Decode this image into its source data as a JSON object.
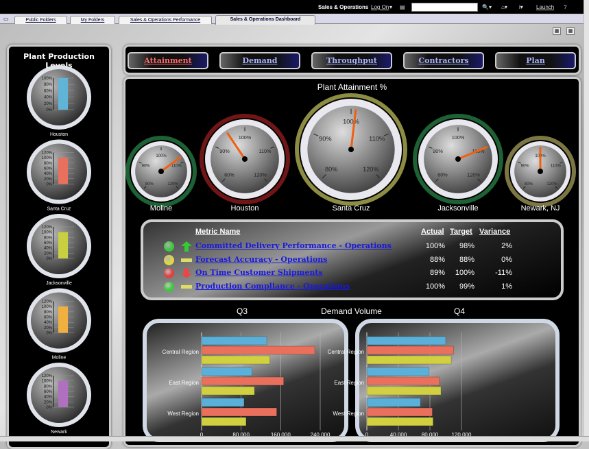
{
  "header": {
    "app_title": "Sales & Operations",
    "log_on": "Log On",
    "launch": "Launch",
    "help": "?",
    "search_value": ""
  },
  "tabs": [
    {
      "label": "Public Folders"
    },
    {
      "label": "My Folders"
    },
    {
      "label": "Sales & Operations Performance"
    },
    {
      "label": "Sales & Operations Dashboard",
      "active": true
    }
  ],
  "left_panel": {
    "title": "Plant Production Levels",
    "plants": [
      {
        "name": "Houston",
        "value": 100,
        "max": 100,
        "ticks": [
          "100%",
          "80%",
          "60%",
          "40%",
          "20%",
          "0%"
        ],
        "color": "#5fb4d8"
      },
      {
        "name": "Santa Cruz",
        "value": 100,
        "max": 120,
        "ticks": [
          "120%",
          "100%",
          "80%",
          "60%",
          "40%",
          "20%",
          "0%"
        ],
        "color": "#e8705c"
      },
      {
        "name": "Jacksonville",
        "value": 100,
        "max": 120,
        "ticks": [
          "120%",
          "100%",
          "80%",
          "60%",
          "40%",
          "20%",
          "0%"
        ],
        "color": "#c8d040"
      },
      {
        "name": "Moline",
        "value": 100,
        "max": 120,
        "ticks": [
          "120%",
          "100%",
          "80%",
          "60%",
          "40%",
          "20%",
          "0%"
        ],
        "color": "#f0b040"
      },
      {
        "name": "Newark",
        "value": 100,
        "max": 120,
        "ticks": [
          "120%",
          "100%",
          "80%",
          "60%",
          "40%",
          "20%",
          "0%"
        ],
        "color": "#b070c0"
      }
    ]
  },
  "nav": [
    {
      "label": "Attainment",
      "active": true
    },
    {
      "label": "Demand"
    },
    {
      "label": "Throughput"
    },
    {
      "label": "Contractors"
    },
    {
      "label": "Plan"
    }
  ],
  "attainment": {
    "title": "Plant Attainment %",
    "range": [
      80,
      120
    ],
    "ticks": [
      "80%",
      "90%",
      "100%",
      "110%",
      "120%"
    ],
    "gauges": [
      {
        "name": "Moline",
        "value": 108,
        "glow": "#2a8a4a"
      },
      {
        "name": "Houston",
        "value": 95,
        "glow": "#a02020"
      },
      {
        "name": "Santa Cruz",
        "value": 101,
        "glow": "#c8c860"
      },
      {
        "name": "Jacksonville",
        "value": 110,
        "glow": "#2a8a4a"
      },
      {
        "name": "Newark, NJ",
        "value": 100,
        "glow": "#b0a860"
      }
    ]
  },
  "metrics": {
    "headers": {
      "name": "Metric Name",
      "actual": "Actual",
      "target": "Target",
      "variance": "Variance"
    },
    "rows": [
      {
        "name": "Committed Delivery Performance - Operations",
        "actual": "100%",
        "target": "98%",
        "variance": "2%",
        "status": "green",
        "trend": "up"
      },
      {
        "name": "Forecast Accuracy - Operations",
        "actual": "88%",
        "target": "88%",
        "variance": "0%",
        "status": "yellow",
        "trend": "flat"
      },
      {
        "name": "On Time Customer Shipments",
        "actual": "89%",
        "target": "100%",
        "variance": "-11%",
        "status": "red",
        "trend": "down"
      },
      {
        "name": "Production Compliance - Operations",
        "actual": "100%",
        "target": "99%",
        "variance": "1%",
        "status": "green",
        "trend": "flat"
      }
    ]
  },
  "demand": {
    "title": "Demand Volume"
  },
  "chart_data": [
    {
      "type": "bar",
      "orientation": "horizontal",
      "title": "Q3",
      "categories": [
        "Central Region",
        "East Region",
        "West Region"
      ],
      "xlim": [
        0,
        240000
      ],
      "xticks": [
        "0",
        "80,000",
        "160,000",
        "240,000"
      ],
      "series": [
        {
          "values": [
            132000,
            102000,
            86000
          ],
          "color": "#5ab0d8"
        },
        {
          "values": [
            229000,
            166000,
            152000
          ],
          "color": "#e8705c"
        },
        {
          "values": [
            138000,
            107000,
            90000
          ],
          "color": "#d0d040"
        }
      ]
    },
    {
      "type": "bar",
      "orientation": "horizontal",
      "title": "Q4",
      "categories": [
        "Central Region",
        "East Region",
        "West Region"
      ],
      "xlim": [
        0,
        120000
      ],
      "xticks": [
        "0",
        "40,000",
        "80,000",
        "120,000"
      ],
      "series": [
        {
          "values": [
            100000,
            79000,
            68000
          ],
          "color": "#5ab0d8"
        },
        {
          "values": [
            110000,
            92000,
            83000
          ],
          "color": "#e8705c"
        },
        {
          "values": [
            107000,
            94000,
            84000
          ],
          "color": "#d0d040"
        }
      ]
    }
  ]
}
